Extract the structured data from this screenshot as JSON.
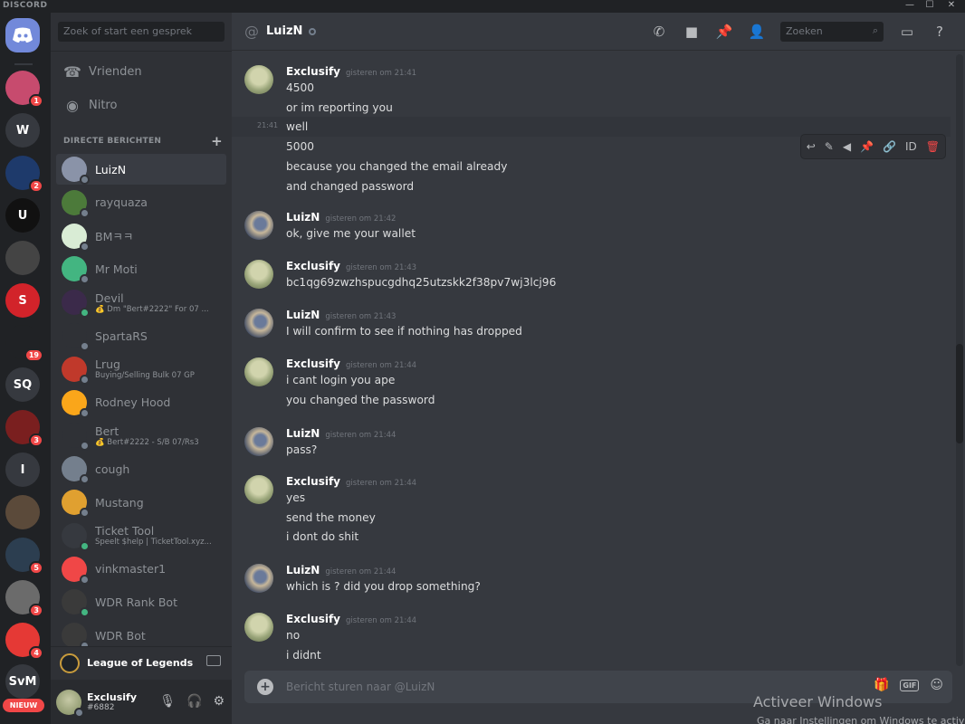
{
  "titlebar": {
    "brand": "DISCORD",
    "min": "—",
    "max": "☐",
    "close": "✕"
  },
  "servers": {
    "home_icon": "discord-logo-icon",
    "list": [
      {
        "initials": "",
        "badge": "1",
        "color": "#c74b6e"
      },
      {
        "initials": "W",
        "badge": "",
        "color": "#36393f"
      },
      {
        "initials": "",
        "badge": "2",
        "color": "#1e3a6b"
      },
      {
        "initials": "U",
        "badge": "",
        "color": "#111111"
      },
      {
        "initials": "",
        "badge": "",
        "color": "#444444"
      },
      {
        "initials": "S",
        "badge": "",
        "color": "#d2232a"
      },
      {
        "initials": "",
        "badge": "19",
        "color": "#202225"
      },
      {
        "initials": "SQ",
        "badge": "",
        "color": "#36393f"
      },
      {
        "initials": "",
        "badge": "3",
        "color": "#7a1f1f"
      },
      {
        "initials": "I",
        "badge": "",
        "color": "#36393f"
      },
      {
        "initials": "",
        "badge": "",
        "color": "#5b4a3a"
      },
      {
        "initials": "",
        "badge": "5",
        "color": "#2c3e50"
      },
      {
        "initials": "",
        "badge": "3",
        "color": "#6b6b6b"
      },
      {
        "initials": "",
        "badge": "4",
        "color": "#e53935"
      },
      {
        "initials": "SvM",
        "badge": "",
        "color": "#36393f"
      }
    ],
    "new_label": "NIEUW"
  },
  "sidebar": {
    "search_placeholder": "Zoek of start een gesprek",
    "nav": [
      {
        "label": "Vrienden",
        "icon": "friends-icon"
      },
      {
        "label": "Nitro",
        "icon": "nitro-icon"
      }
    ],
    "dm_header": "DIRECTE BERICHTEN",
    "dms": [
      {
        "name": "LuizN",
        "sub": "",
        "online": false,
        "active": true,
        "color": "#8a93a8"
      },
      {
        "name": "rayquaza",
        "sub": "",
        "online": false,
        "active": false,
        "color": "#4c7a3a"
      },
      {
        "name": "BMㅋㅋ",
        "sub": "",
        "online": false,
        "active": false,
        "color": "#d9ecd5"
      },
      {
        "name": "Mr Moti",
        "sub": "",
        "online": false,
        "active": false,
        "color": "#43b581"
      },
      {
        "name": "Devil",
        "sub": "💰 Dm \"Bert#2222\" For 07 ...",
        "online": true,
        "active": false,
        "color": "#3b2a4a"
      },
      {
        "name": "SpartaRS",
        "sub": "",
        "online": false,
        "active": false,
        "color": "#2f3136"
      },
      {
        "name": "Lrug",
        "sub": "Buying/Selling Bulk 07 GP",
        "online": false,
        "active": false,
        "color": "#c0392b"
      },
      {
        "name": "Rodney Hood",
        "sub": "",
        "online": false,
        "active": false,
        "color": "#faa61a"
      },
      {
        "name": "Bert",
        "sub": "💰 Bert#2222 - S/B 07/Rs3",
        "online": false,
        "active": false,
        "color": "#2f3136"
      },
      {
        "name": "cough",
        "sub": "",
        "online": false,
        "active": false,
        "color": "#747f8d"
      },
      {
        "name": "Mustang",
        "sub": "",
        "online": false,
        "active": false,
        "color": "#e0a030"
      },
      {
        "name": "Ticket Tool",
        "sub": "Speelt $help | TicketTool.xyz...",
        "online": true,
        "active": false,
        "color": "#36393f"
      },
      {
        "name": "vinkmaster1",
        "sub": "",
        "online": false,
        "active": false,
        "color": "#f04747"
      },
      {
        "name": "WDR Rank Bot",
        "sub": "",
        "online": true,
        "active": false,
        "color": "#3a3a3a"
      },
      {
        "name": "WDR Bot",
        "sub": "",
        "online": false,
        "active": false,
        "color": "#3a3a3a"
      }
    ],
    "game": {
      "title": "League of Legends"
    },
    "user": {
      "name": "Exclusify",
      "tag": "#6882"
    }
  },
  "chat": {
    "channel": "LuizN",
    "search_placeholder": "Zoeken",
    "hover_time": "21:41",
    "composer_placeholder": "Bericht sturen naar @LuizN",
    "gif_label": "GIF",
    "groups": [
      {
        "author": "Exclusify",
        "time": "gisteren om 21:41",
        "lines": [
          "4500",
          "or im reporting you",
          "well",
          "5000",
          "because you changed the email already",
          "and changed password"
        ]
      },
      {
        "author": "LuizN",
        "time": "gisteren om 21:42",
        "lines": [
          "ok, give me your wallet"
        ]
      },
      {
        "author": "Exclusify",
        "time": "gisteren om 21:43",
        "lines": [
          "bc1qg69zwzhspucgdhq25utzskk2f38pv7wj3lcj96"
        ]
      },
      {
        "author": "LuizN",
        "time": "gisteren om 21:43",
        "lines": [
          "I will confirm to see if nothing has dropped"
        ]
      },
      {
        "author": "Exclusify",
        "time": "gisteren om 21:44",
        "lines": [
          "i cant login you ape",
          "you changed the password"
        ]
      },
      {
        "author": "LuizN",
        "time": "gisteren om 21:44",
        "lines": [
          "pass?"
        ]
      },
      {
        "author": "Exclusify",
        "time": "gisteren om 21:44",
        "lines": [
          "yes",
          "send the money",
          "i dont do shit"
        ]
      },
      {
        "author": "LuizN",
        "time": "gisteren om 21:44",
        "lines": [
          "which is ? did you drop something?"
        ]
      },
      {
        "author": "Exclusify",
        "time": "gisteren om 21:44",
        "lines": [
          "no",
          "i didnt"
        ]
      }
    ]
  },
  "watermark": {
    "title": "Activeer Windows",
    "sub": "Ga naar Instellingen om Windows te activ"
  }
}
